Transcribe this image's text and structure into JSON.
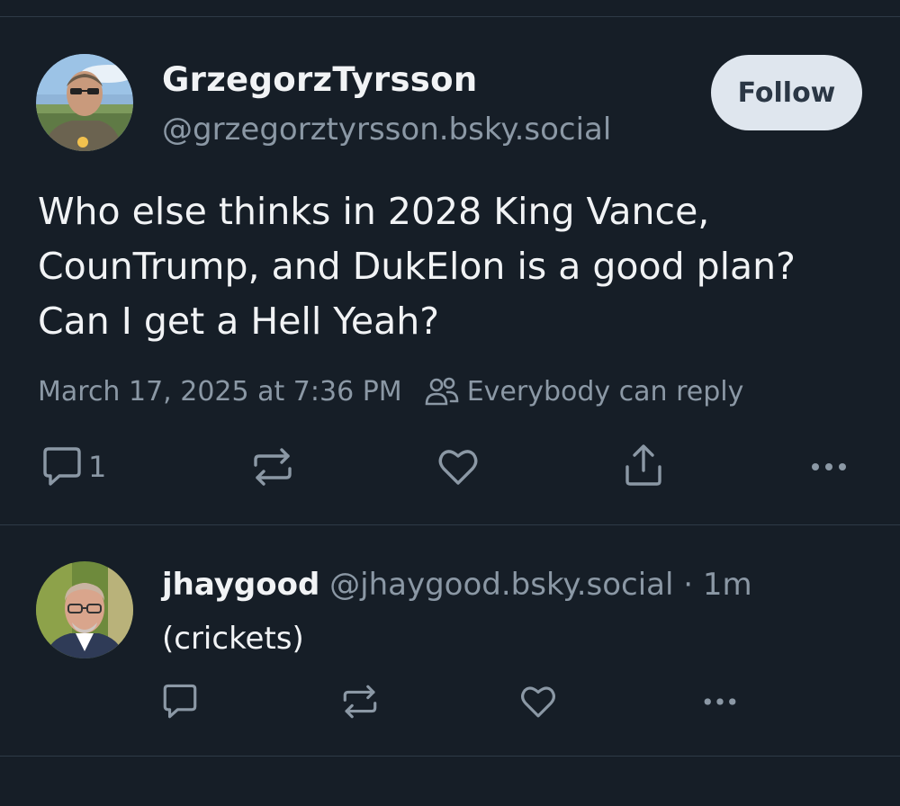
{
  "post": {
    "author": {
      "display_name": "GrzegorzTyrsson",
      "handle": "@grzegorztyrsson.bsky.social"
    },
    "follow_label": "Follow",
    "text_lines": [
      "Who else thinks in 2028 King Vance,",
      "CounTrump, and DukElon is a good plan?",
      "Can I get a Hell Yeah?"
    ],
    "timestamp": "March 17, 2025 at 7:36 PM",
    "reply_setting": "Everybody can reply",
    "reply_count": "1",
    "icons": [
      "reply-icon",
      "repost-icon",
      "like-icon",
      "share-icon",
      "more-icon",
      "people-icon"
    ]
  },
  "reply": {
    "display_name": "jhaygood",
    "handle": "@jhaygood.bsky.social",
    "separator": "·",
    "time": "1m",
    "text": "(crickets)"
  },
  "colors": {
    "background": "#161e27",
    "text_primary": "#f1f3f5",
    "text_secondary": "#8b98a5",
    "follow_button_bg": "#dfe6ee",
    "divider": "#2e3a47"
  }
}
